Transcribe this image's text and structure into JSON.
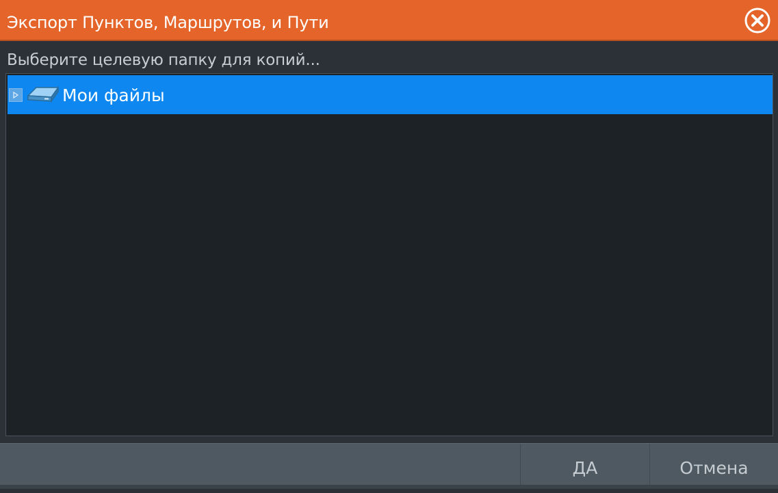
{
  "dialog": {
    "title": "Экспорт Пунктов, Маршрутов, и Пути",
    "prompt": "Выберите целевую папку для копий..."
  },
  "tree": {
    "items": [
      {
        "label": "Мои файлы",
        "icon": "drive-icon",
        "selected": true,
        "expandable": true
      }
    ]
  },
  "footer": {
    "ok_label": "ДА",
    "cancel_label": "Отмена"
  },
  "colors": {
    "titlebar": "#e4642a",
    "selection": "#0e88f0",
    "panel": "#1d2226",
    "footer": "#4e5962"
  }
}
